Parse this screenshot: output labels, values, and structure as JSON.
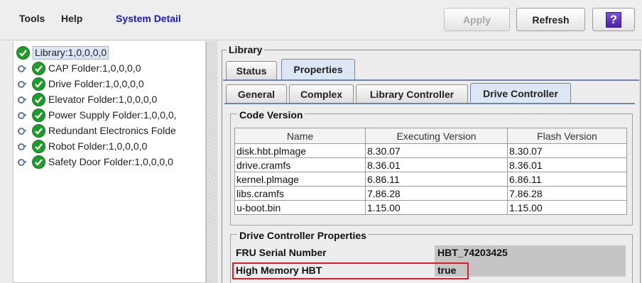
{
  "menu": {
    "tools": "Tools",
    "help": "Help",
    "system_detail": "System Detail"
  },
  "toolbar": {
    "apply": "Apply",
    "refresh": "Refresh",
    "help_glyph": "?"
  },
  "tree": {
    "root": "Library:1,0,0,0,0",
    "items": [
      "CAP Folder:1,0,0,0,0",
      "Drive Folder:1,0,0,0,0",
      "Elevator Folder:1,0,0,0,0",
      "Power Supply Folder:1,0,0,0,",
      "Redundant Electronics Folde",
      "Robot Folder:1,0,0,0,0",
      "Safety Door Folder:1,0,0,0,0"
    ],
    "status_icon": "green-check-icon",
    "handle_icon": "tree-expand-handle-icon"
  },
  "library": {
    "title": "Library",
    "tabs": [
      "Status",
      "Properties"
    ],
    "selected_tab": "Properties",
    "subtabs": [
      "General",
      "Complex",
      "Library Controller",
      "Drive Controller"
    ],
    "selected_subtab": "Drive Controller"
  },
  "code_version": {
    "title": "Code Version",
    "columns": [
      "Name",
      "Executing Version",
      "Flash Version"
    ],
    "rows": [
      [
        "disk.hbt.plmage",
        "8.30.07",
        "8.30.07"
      ],
      [
        "drive.cramfs",
        "8.36.01",
        "8.36.01"
      ],
      [
        "kernel.plmage",
        "6.86.11",
        "6.86.11"
      ],
      [
        "libs.cramfs",
        "7.86.28",
        "7.86.28"
      ],
      [
        "u-boot.bin",
        "1.15.00",
        "1.15.00"
      ]
    ]
  },
  "drive_controller_properties": {
    "title": "Drive Controller Properties",
    "fru_label": "FRU Serial Number",
    "fru_value": "HBT_74203425",
    "hbt_label": "High Memory HBT",
    "hbt_value": "true"
  },
  "colors": {
    "accent_link": "#1a1ac8",
    "selection_tab": "#dce6f4",
    "highlight_box": "#e11b28",
    "ok_green": "#1e9b2a"
  }
}
